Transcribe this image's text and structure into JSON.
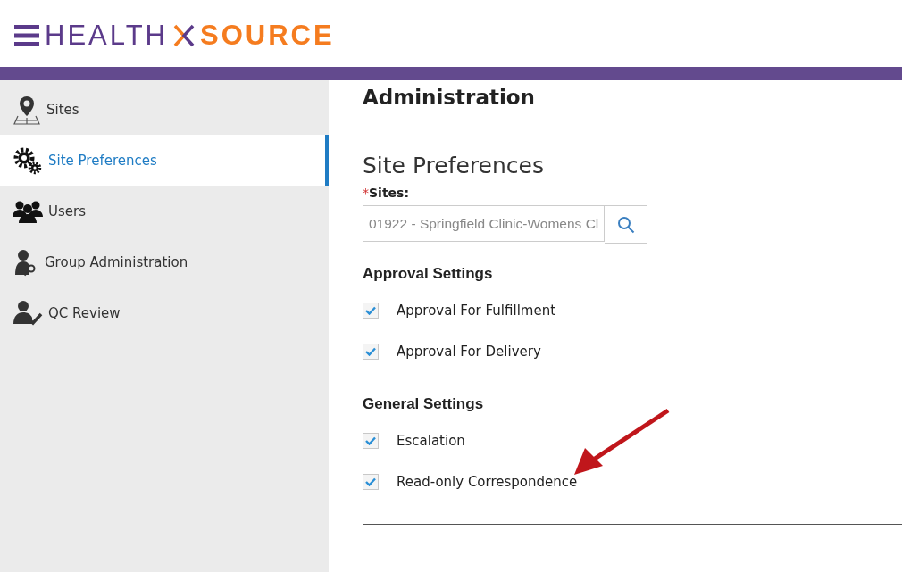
{
  "header": {
    "logo": {
      "word_1": "HEALTH",
      "word_2": "SOURCE"
    }
  },
  "sidebar": {
    "items": [
      {
        "label": "Sites",
        "selected": false
      },
      {
        "label": "Site Preferences",
        "selected": true
      },
      {
        "label": "Users",
        "selected": false
      },
      {
        "label": "Group Administration",
        "selected": false
      },
      {
        "label": "QC Review",
        "selected": false
      }
    ]
  },
  "main": {
    "title": "Administration",
    "section_title": "Site Preferences",
    "sites_field": {
      "required_mark": "*",
      "label": "Sites:",
      "value": "01922 - Springfield Clinic-Womens Cl"
    },
    "groups": [
      {
        "title": "Approval Settings",
        "options": [
          {
            "label": "Approval For Fulfillment",
            "checked": true
          },
          {
            "label": "Approval For Delivery",
            "checked": true
          }
        ]
      },
      {
        "title": "General Settings",
        "options": [
          {
            "label": "Escalation",
            "checked": true
          },
          {
            "label": "Read-only Correspondence",
            "checked": true
          }
        ]
      }
    ]
  }
}
